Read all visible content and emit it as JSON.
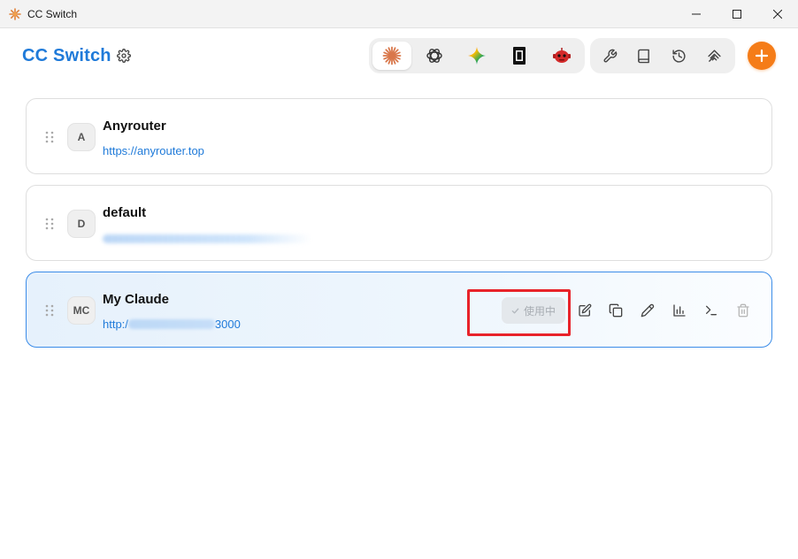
{
  "window": {
    "title": "CC Switch",
    "controls": [
      "minimize-icon",
      "maximize-icon",
      "close-icon"
    ]
  },
  "header": {
    "brand": "CC Switch",
    "settings_icon": "gear-icon",
    "app_tabs": [
      {
        "name": "claude",
        "icon": "claude-asterisk-icon",
        "active": true
      },
      {
        "name": "openai",
        "icon": "openai-knot-icon",
        "active": false
      },
      {
        "name": "gemini",
        "icon": "gemini-sparkle-icon",
        "active": false
      },
      {
        "name": "terminal-app",
        "icon": "black-block-icon",
        "active": false
      },
      {
        "name": "robot-app",
        "icon": "red-robot-icon",
        "active": false
      }
    ],
    "tool_tabs": [
      {
        "name": "tools",
        "icon": "wrench-icon"
      },
      {
        "name": "docs",
        "icon": "book-icon"
      },
      {
        "name": "history",
        "icon": "history-icon"
      },
      {
        "name": "mcp",
        "icon": "link-stack-icon"
      }
    ],
    "add_icon": "plus-icon"
  },
  "providers": [
    {
      "avatar": "A",
      "name": "Anyrouter",
      "url": "https://anyrouter.top",
      "active": false
    },
    {
      "avatar": "D",
      "name": "default",
      "url": "",
      "active": false
    },
    {
      "avatar": "MC",
      "name": "My Claude",
      "url_prefix": "http:/",
      "url_suffix": "3000",
      "active": true
    }
  ],
  "active_card": {
    "status_label": "使用中",
    "status_icon": "check-icon",
    "actions": [
      "edit-icon",
      "copy-icon",
      "pen-icon",
      "bar-chart-icon",
      "terminal-icon",
      "trash-icon"
    ]
  },
  "colors": {
    "brand": "#1f7ad9",
    "accent": "#f57c18",
    "active_border": "#3b8ce8",
    "highlight": "#e8232a"
  }
}
